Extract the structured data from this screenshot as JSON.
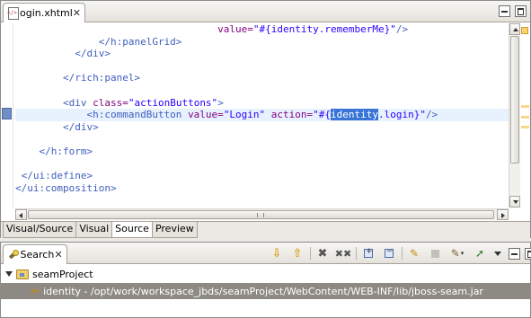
{
  "editor": {
    "tab_label": "login.xhtml",
    "tab_close": "✕",
    "code": [
      [
        {
          "c": "tok-attr",
          "t": "                                  value="
        },
        {
          "c": "tok-val",
          "t": "\"#{identity.rememberMe}\""
        },
        {
          "c": "tok-tag",
          "t": "/>"
        }
      ],
      [
        {
          "c": "tok-tag",
          "t": "              </h:panelGrid>"
        }
      ],
      [
        {
          "c": "tok-tag",
          "t": "          </div>"
        }
      ],
      [
        {
          "c": "",
          "t": ""
        }
      ],
      [
        {
          "c": "tok-tag",
          "t": "        </rich:panel>"
        }
      ],
      [
        {
          "c": "",
          "t": ""
        }
      ],
      [
        {
          "c": "tok-tag",
          "t": "        <div "
        },
        {
          "c": "tok-attr",
          "t": "class="
        },
        {
          "c": "tok-val",
          "t": "\"actionButtons\""
        },
        {
          "c": "tok-tag",
          "t": ">"
        }
      ],
      [
        {
          "c": "tok-tag",
          "t": "            <h:commandButton "
        },
        {
          "c": "tok-attr",
          "t": "value="
        },
        {
          "c": "tok-val",
          "t": "\"Login\""
        },
        {
          "c": "",
          "t": " "
        },
        {
          "c": "tok-attr",
          "t": "action="
        },
        {
          "c": "tok-val",
          "t": "\"#{"
        },
        {
          "c": "tok-sel",
          "t": "identity"
        },
        {
          "c": "tok-val",
          "t": ".login}\""
        },
        {
          "c": "tok-tag",
          "t": "/>"
        }
      ],
      [
        {
          "c": "tok-tag",
          "t": "        </div>"
        }
      ],
      [
        {
          "c": "",
          "t": ""
        }
      ],
      [
        {
          "c": "tok-tag",
          "t": "    </h:form>"
        }
      ],
      [
        {
          "c": "",
          "t": ""
        }
      ],
      [
        {
          "c": "tok-tag",
          "t": " </ui:define>"
        }
      ],
      [
        {
          "c": "tok-tag",
          "t": "</ui:composition>"
        }
      ]
    ],
    "current_line": 7,
    "bottom_tabs": [
      {
        "label": "Visual/Source",
        "active": false
      },
      {
        "label": "Visual",
        "active": false
      },
      {
        "label": "Source",
        "active": true
      },
      {
        "label": "Preview",
        "active": false
      }
    ]
  },
  "search": {
    "tab_label": "Search",
    "tab_close": "✕",
    "toolbar": {
      "next_match": "⇩",
      "prev_match": "⇧",
      "remove_match": "✖",
      "remove_all": "✖✖",
      "pin": "✎",
      "history": "✎",
      "dropdown": "▾",
      "pin_view": "➚"
    },
    "project": "seamProject",
    "match_icon": "✂",
    "result": "identity - /opt/work/workspace_jbds/seamProject/WebContent/WEB-INF/lib/jboss-seam.jar"
  },
  "colors": {
    "tag": "#3f5fbf",
    "attribute": "#7f007f",
    "value": "#2a00ff",
    "selection": "#3875d7",
    "current_line": "#e8f2fe",
    "selected_row": "#8d8a83"
  }
}
